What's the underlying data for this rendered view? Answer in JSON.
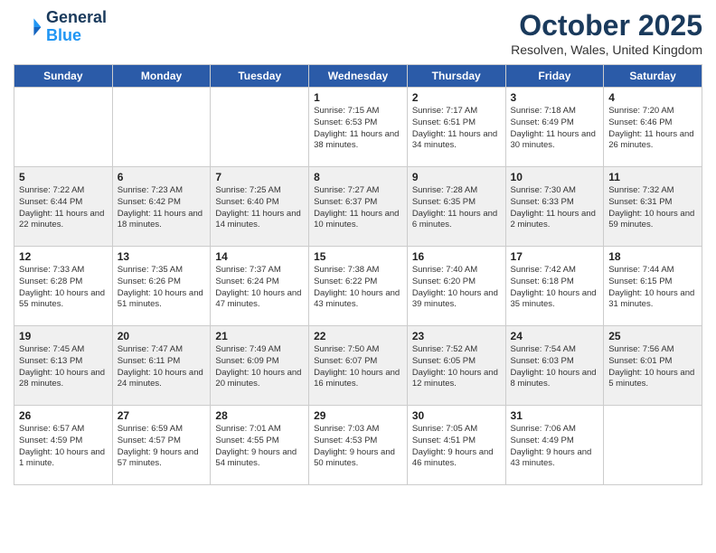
{
  "header": {
    "logo_general": "General",
    "logo_blue": "Blue",
    "month_title": "October 2025",
    "location": "Resolven, Wales, United Kingdom"
  },
  "days_of_week": [
    "Sunday",
    "Monday",
    "Tuesday",
    "Wednesday",
    "Thursday",
    "Friday",
    "Saturday"
  ],
  "weeks": [
    [
      {
        "day": "",
        "content": ""
      },
      {
        "day": "",
        "content": ""
      },
      {
        "day": "",
        "content": ""
      },
      {
        "day": "1",
        "content": "Sunrise: 7:15 AM\nSunset: 6:53 PM\nDaylight: 11 hours\nand 38 minutes."
      },
      {
        "day": "2",
        "content": "Sunrise: 7:17 AM\nSunset: 6:51 PM\nDaylight: 11 hours\nand 34 minutes."
      },
      {
        "day": "3",
        "content": "Sunrise: 7:18 AM\nSunset: 6:49 PM\nDaylight: 11 hours\nand 30 minutes."
      },
      {
        "day": "4",
        "content": "Sunrise: 7:20 AM\nSunset: 6:46 PM\nDaylight: 11 hours\nand 26 minutes."
      }
    ],
    [
      {
        "day": "5",
        "content": "Sunrise: 7:22 AM\nSunset: 6:44 PM\nDaylight: 11 hours\nand 22 minutes."
      },
      {
        "day": "6",
        "content": "Sunrise: 7:23 AM\nSunset: 6:42 PM\nDaylight: 11 hours\nand 18 minutes."
      },
      {
        "day": "7",
        "content": "Sunrise: 7:25 AM\nSunset: 6:40 PM\nDaylight: 11 hours\nand 14 minutes."
      },
      {
        "day": "8",
        "content": "Sunrise: 7:27 AM\nSunset: 6:37 PM\nDaylight: 11 hours\nand 10 minutes."
      },
      {
        "day": "9",
        "content": "Sunrise: 7:28 AM\nSunset: 6:35 PM\nDaylight: 11 hours\nand 6 minutes."
      },
      {
        "day": "10",
        "content": "Sunrise: 7:30 AM\nSunset: 6:33 PM\nDaylight: 11 hours\nand 2 minutes."
      },
      {
        "day": "11",
        "content": "Sunrise: 7:32 AM\nSunset: 6:31 PM\nDaylight: 10 hours\nand 59 minutes."
      }
    ],
    [
      {
        "day": "12",
        "content": "Sunrise: 7:33 AM\nSunset: 6:28 PM\nDaylight: 10 hours\nand 55 minutes."
      },
      {
        "day": "13",
        "content": "Sunrise: 7:35 AM\nSunset: 6:26 PM\nDaylight: 10 hours\nand 51 minutes."
      },
      {
        "day": "14",
        "content": "Sunrise: 7:37 AM\nSunset: 6:24 PM\nDaylight: 10 hours\nand 47 minutes."
      },
      {
        "day": "15",
        "content": "Sunrise: 7:38 AM\nSunset: 6:22 PM\nDaylight: 10 hours\nand 43 minutes."
      },
      {
        "day": "16",
        "content": "Sunrise: 7:40 AM\nSunset: 6:20 PM\nDaylight: 10 hours\nand 39 minutes."
      },
      {
        "day": "17",
        "content": "Sunrise: 7:42 AM\nSunset: 6:18 PM\nDaylight: 10 hours\nand 35 minutes."
      },
      {
        "day": "18",
        "content": "Sunrise: 7:44 AM\nSunset: 6:15 PM\nDaylight: 10 hours\nand 31 minutes."
      }
    ],
    [
      {
        "day": "19",
        "content": "Sunrise: 7:45 AM\nSunset: 6:13 PM\nDaylight: 10 hours\nand 28 minutes."
      },
      {
        "day": "20",
        "content": "Sunrise: 7:47 AM\nSunset: 6:11 PM\nDaylight: 10 hours\nand 24 minutes."
      },
      {
        "day": "21",
        "content": "Sunrise: 7:49 AM\nSunset: 6:09 PM\nDaylight: 10 hours\nand 20 minutes."
      },
      {
        "day": "22",
        "content": "Sunrise: 7:50 AM\nSunset: 6:07 PM\nDaylight: 10 hours\nand 16 minutes."
      },
      {
        "day": "23",
        "content": "Sunrise: 7:52 AM\nSunset: 6:05 PM\nDaylight: 10 hours\nand 12 minutes."
      },
      {
        "day": "24",
        "content": "Sunrise: 7:54 AM\nSunset: 6:03 PM\nDaylight: 10 hours\nand 8 minutes."
      },
      {
        "day": "25",
        "content": "Sunrise: 7:56 AM\nSunset: 6:01 PM\nDaylight: 10 hours\nand 5 minutes."
      }
    ],
    [
      {
        "day": "26",
        "content": "Sunrise: 6:57 AM\nSunset: 4:59 PM\nDaylight: 10 hours\nand 1 minute."
      },
      {
        "day": "27",
        "content": "Sunrise: 6:59 AM\nSunset: 4:57 PM\nDaylight: 9 hours\nand 57 minutes."
      },
      {
        "day": "28",
        "content": "Sunrise: 7:01 AM\nSunset: 4:55 PM\nDaylight: 9 hours\nand 54 minutes."
      },
      {
        "day": "29",
        "content": "Sunrise: 7:03 AM\nSunset: 4:53 PM\nDaylight: 9 hours\nand 50 minutes."
      },
      {
        "day": "30",
        "content": "Sunrise: 7:05 AM\nSunset: 4:51 PM\nDaylight: 9 hours\nand 46 minutes."
      },
      {
        "day": "31",
        "content": "Sunrise: 7:06 AM\nSunset: 4:49 PM\nDaylight: 9 hours\nand 43 minutes."
      },
      {
        "day": "",
        "content": ""
      }
    ]
  ]
}
